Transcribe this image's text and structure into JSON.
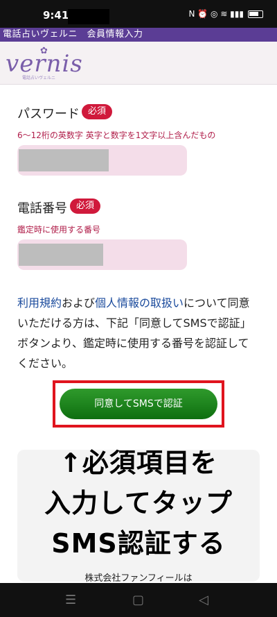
{
  "status": {
    "time": "9:41",
    "icons": "N ⏰ ◎ ≋ ▮▮▮"
  },
  "title_bar": {
    "text": "電話占いヴェルニ　会員情報入力"
  },
  "logo": {
    "word": "vernis",
    "sub": "電話占いヴェルニ"
  },
  "password": {
    "label": "パスワード",
    "badge": "必須",
    "hint": "6〜12桁の英数字 英字と数字を1文字以上含んだもの"
  },
  "phone": {
    "label": "電話番号",
    "badge": "必須",
    "hint": "鑑定時に使用する番号"
  },
  "consent": {
    "terms_link": "利用規約",
    "mid1": "および",
    "privacy_link": "個人情報の取扱い",
    "rest": "について同意いただける方は、下記「同意してSMSで認証」ボタンより、鑑定時に使用する番号を認証してください。"
  },
  "button": {
    "label": "同意してSMSで認証"
  },
  "overlay": {
    "line1": "↑必須項目を",
    "line2": "入力してタップ",
    "line3": "SMS認証する"
  },
  "footer": {
    "text": "株式会社ファンフィールは"
  },
  "nav": {
    "menu": "☰",
    "home": "▢",
    "back": "◁"
  },
  "colors": {
    "brand": "#5b3d95",
    "required": "#d0193b",
    "button": "#1a7f1c",
    "highlight": "#e0141e"
  }
}
